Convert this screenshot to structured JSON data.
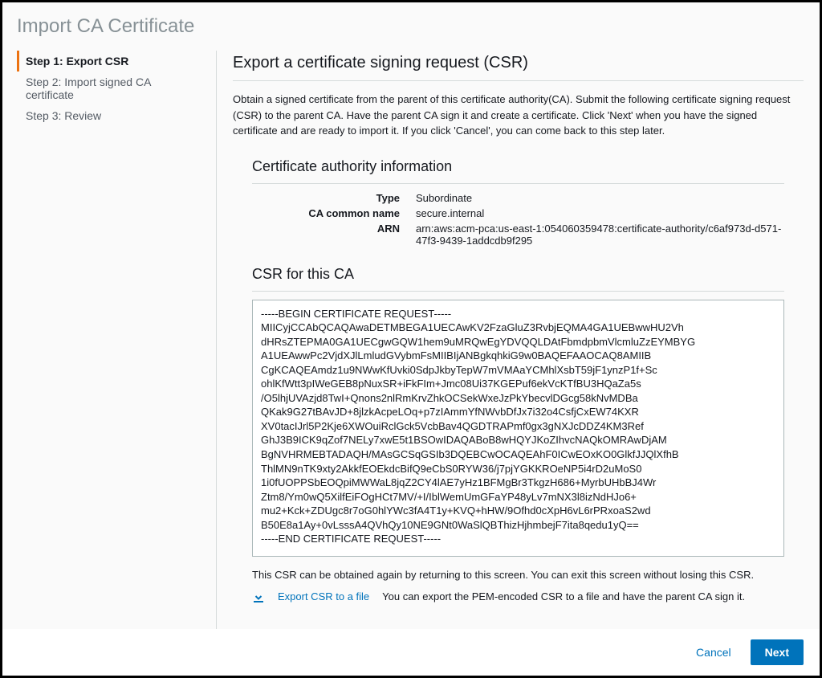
{
  "page_title": "Import CA Certificate",
  "steps": [
    {
      "label": "Step 1: Export CSR"
    },
    {
      "label": "Step 2: Import signed CA certificate"
    },
    {
      "label": "Step 3: Review"
    }
  ],
  "main": {
    "heading": "Export a certificate signing request (CSR)",
    "intro": "Obtain a signed certificate from the parent of this certificate authority(CA). Submit the following certificate signing request (CSR) to the parent CA. Have the parent CA sign it and create a certificate. Click 'Next' when you have the signed certificate and are ready to import it. If you click 'Cancel', you can come back to this step later.",
    "ca_info": {
      "heading": "Certificate authority information",
      "type_label": "Type",
      "type_value": "Subordinate",
      "common_name_label": "CA common name",
      "common_name_value": "secure.internal",
      "arn_label": "ARN",
      "arn_value": "arn:aws:acm-pca:us-east-1:054060359478:certificate-authority/c6af973d-d571-47f3-9439-1addcdb9f295"
    },
    "csr": {
      "heading": "CSR for this CA",
      "body": "-----BEGIN CERTIFICATE REQUEST-----\nMIICyjCCAbQCAQAwaDETMBEGA1UECAwKV2FzaGluZ3RvbjEQMA4GA1UEBwwHU2Vh\ndHRsZTEPMA0GA1UECgwGQW1hem9uMRQwEgYDVQQLDAtFbmdpbmVlcmluZzEYMBYG\nA1UEAwwPc2VjdXJlLmludGVybmFsMIIBIjANBgkqhkiG9w0BAQEFAAOCAQ8AMIIB\nCgKCAQEAmdz1u9NWwKfUvki0SdpJkbyTepW7mVMAaYCMhlXsbT59jF1ynzP1f+Sc\nohlKfWtt3pIWeGEB8pNuxSR+iFkFIm+Jmc08Ui37KGEPuf6ekVcKTfBU3HQaZa5s\n/O5lhjUVAzjd8TwI+Qnons2nlRmKrvZhkOCSekWxeJzPkYbecvlDGcg58kNvMDBa\nQKak9G27tBAvJD+8jlzkAcpeLOq+p7zIAmmYfNWvbDfJx7i32o4CsfjCxEW74KXR\nXV0tacIJrl5P2Kje6XWOuiRclGck5VcbBav4QGDTRAPmf0gx3gNXJcDDZ4KM3Ref\nGhJ3B9ICK9qZof7NELy7xwE5t1BSOwIDAQABoB8wHQYJKoZIhvcNAQkOMRAwDjAM\nBgNVHRMEBTADAQH/MAsGCSqGSIb3DQEBCwOCAQEAhF0ICwEOxKO0GlkfJJQlXfhB\nThlMN9nTK9xty2AkkfEOEkdcBifQ9eCbS0RYW36/j7pjYGKKROeNP5i4rD2uMoS0\n1i0fUOPPSbEOQpiMWWaL8jqZ2CY4lAE7yHz1BFMgBr3TkgzH686+MyrbUHbBJ4Wr\nZtm8/Ym0wQ5XilfEiFOgHCt7MV/+I/IblWemUmGFaYP48yLv7mNX3l8izNdHJo6+\nmu2+Kck+ZDUgc8r7oG0hlYWc3fA4T1y+KVQ+hHW/9Ofhd0cXpH6vL6rPRxoaS2wd\nB50E8a1Ay+0vLsssA4QVhQy10NE9GNt0WaSlQBThizHjhmbejF7ita8qedu1yQ==\n-----END CERTIFICATE REQUEST-----",
      "note": "This CSR can be obtained again by returning to this screen. You can exit this screen without losing this CSR.",
      "export_link": "Export CSR to a file",
      "export_desc": "You can export the PEM-encoded CSR to a file and have the parent CA sign it."
    }
  },
  "footer": {
    "cancel": "Cancel",
    "next": "Next"
  }
}
